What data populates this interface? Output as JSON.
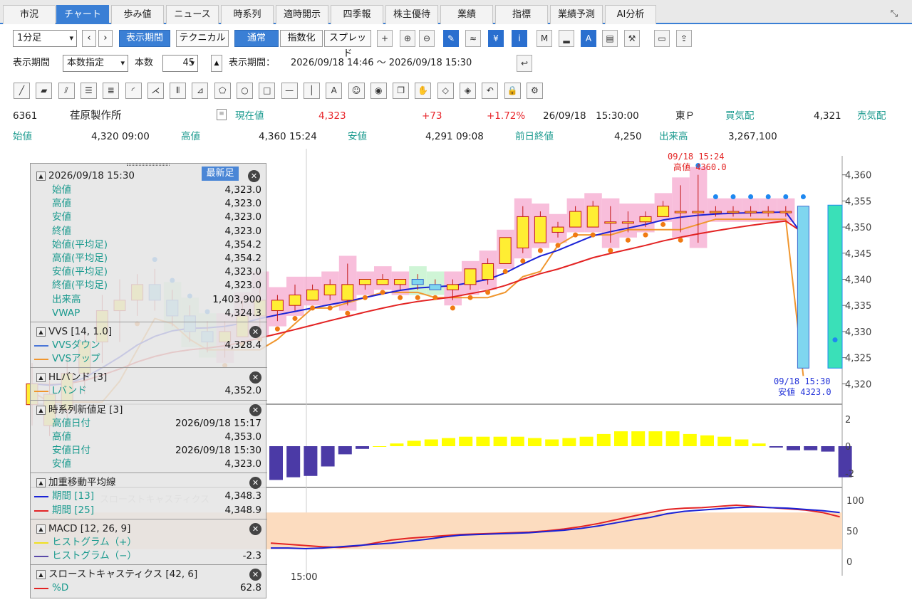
{
  "tabs": [
    "市況",
    "チャート",
    "歩み値",
    "ニュース",
    "時系列",
    "適時開示",
    "四季報",
    "株主優待",
    "業績",
    "指標",
    "業績予測",
    "AI分析"
  ],
  "active_tab": 1,
  "toolbar": {
    "interval": "1分足",
    "period_button": "表示期間",
    "technical_button": "テクニカル",
    "normal_button": "通常",
    "index_button": "指数化",
    "spread_button": "スプレッド",
    "period_label": "表示期間",
    "period_mode": "本数指定",
    "count_label": "本数",
    "count_value": "45",
    "range_label": "表示期間：",
    "range_value": "2026/09/18 14:46 ～ 2026/09/18 15:30"
  },
  "toolbar_icons": [
    "crosshair-icon",
    "zoom-in-icon",
    "zoom-out-icon",
    "pencil-icon",
    "scale-icon",
    "yen-icon",
    "info-icon",
    "my-icon",
    "volume-icon",
    "auto-icon",
    "chart-icon",
    "wrench-icon",
    "print-icon",
    "export-icon"
  ],
  "drawing_tools": [
    "line",
    "ruler",
    "parallel",
    "h-lines",
    "h-lines2",
    "arc",
    "fan",
    "v-lines",
    "gann",
    "pentagon",
    "circle",
    "rectangle",
    "h-line",
    "v-line",
    "text",
    "smile",
    "stamp",
    "copy",
    "hand",
    "eraser",
    "eraser2",
    "undo",
    "lock",
    "gear"
  ],
  "quote": {
    "code": "6361",
    "name": "荏原製作所",
    "current_label": "現在値",
    "current": "4,323",
    "change": "+73",
    "change_pct": "+1.72%",
    "datetime": "26/09/18　15:30:00",
    "market": "東Ｐ",
    "bid_label": "買気配",
    "bid": "4,321",
    "ask_label": "売気配",
    "open_label": "始値",
    "open": "4,320 09:00",
    "high_label": "高値",
    "high": "4,360 15:24",
    "low_label": "安値",
    "low": "4,291 09:08",
    "prev_label": "前日終値",
    "prev": "4,250",
    "volume_label": "出来高",
    "volume": "3,267,100"
  },
  "overlay": {
    "datetime": "2026/09/18 15:30",
    "newest_button": "最新足",
    "price_rows": [
      {
        "k": "始値",
        "v": "4,323.0"
      },
      {
        "k": "高値",
        "v": "4,323.0"
      },
      {
        "k": "安値",
        "v": "4,323.0"
      },
      {
        "k": "終値",
        "v": "4,323.0"
      },
      {
        "k": "始値(平均足)",
        "v": "4,354.2"
      },
      {
        "k": "高値(平均足)",
        "v": "4,354.2"
      },
      {
        "k": "安値(平均足)",
        "v": "4,323.0"
      },
      {
        "k": "終値(平均足)",
        "v": "4,323.0"
      },
      {
        "k": "出来高",
        "v": "1,403,900"
      },
      {
        "k": "VWAP",
        "v": "4,324.3"
      }
    ],
    "vvs_title": "VVS [14, 1.0]",
    "vvs_rows": [
      {
        "k": "VVSダウン",
        "v": "4,328.4",
        "c": "#4a76d8"
      },
      {
        "k": "VVSアップ",
        "v": "",
        "c": "#f0962e"
      }
    ],
    "hl_title": "HLバンド [3]",
    "hl_rows": [
      {
        "k": "Lバンド",
        "v": "4,352.0",
        "c": "#f0962e"
      }
    ],
    "ts_title": "時系列新値足 [3]",
    "ts_rows": [
      {
        "k": "高値日付",
        "v": "2026/09/18 15:17"
      },
      {
        "k": "高値",
        "v": "4,353.0"
      },
      {
        "k": "安値日付",
        "v": "2026/09/18 15:30"
      },
      {
        "k": "安値",
        "v": "4,323.0"
      }
    ],
    "wma_title": "加重移動平均線",
    "wma_rows": [
      {
        "k": "期間 [13]",
        "v": "4,348.3",
        "c": "#1a22d6"
      },
      {
        "k": "期間 [25]",
        "v": "4,348.9",
        "c": "#e32323"
      }
    ],
    "macd_title": "MACD [12, 26, 9]",
    "macd_rows": [
      {
        "k": "ヒストグラム（+）",
        "v": "",
        "c": "#f0e020"
      },
      {
        "k": "ヒストグラム（−）",
        "v": "-2.3",
        "c": "#5a4aa8"
      }
    ],
    "stoch_title": "スローストキャスティクス [42, 6]",
    "stoch_rows": [
      {
        "k": "%D",
        "v": "62.8",
        "c": "#e32323"
      }
    ],
    "watermark": "スローストキャスティクス"
  },
  "chart_data": {
    "type": "candlestick",
    "price_axis": {
      "range": [
        4318,
        4362
      ],
      "ticks": [
        "4,360",
        "4,355",
        "4,350",
        "4,345",
        "4,340",
        "4,335",
        "4,330",
        "4,325",
        "4,320"
      ]
    },
    "time_label": "15:00",
    "high_annotation": {
      "time": "09/18 15:24",
      "label": "高値 4360.0"
    },
    "low_annotation": {
      "time": "09/18 15:30",
      "label": "安値 4323.0"
    },
    "candles": [
      [
        4316,
        4320,
        4312,
        4324
      ],
      [
        4312,
        4318,
        4310,
        4322
      ],
      [
        4315,
        4322,
        4312,
        4325
      ],
      [
        4322,
        4328,
        4318,
        4330
      ],
      [
        4328,
        4334,
        4324,
        4337
      ],
      [
        4334,
        4336,
        4328,
        4340
      ],
      [
        4336,
        4339,
        4333,
        4341
      ],
      [
        4339,
        4336,
        4334,
        4342
      ],
      [
        4336,
        4333,
        4331,
        4338
      ],
      [
        4333,
        4330,
        4328,
        4335
      ],
      [
        4330,
        4328,
        4326,
        4332
      ],
      [
        4328,
        4330,
        4325,
        4332
      ],
      [
        4329,
        4333,
        4329,
        4336
      ],
      [
        4333,
        4336,
        4330,
        4340
      ],
      [
        4334,
        4336,
        4332,
        4337
      ],
      [
        4335,
        4337,
        4334,
        4339
      ],
      [
        4336,
        4338,
        4336,
        4339
      ],
      [
        4337,
        4339,
        4336,
        4340
      ],
      [
        4336,
        4339,
        4335,
        4343
      ],
      [
        4339,
        4340,
        4338,
        4340
      ],
      [
        4339,
        4340,
        4339,
        4341
      ],
      [
        4339,
        4340,
        4338,
        4340
      ],
      [
        4340,
        4339,
        4338,
        4341
      ],
      [
        4339,
        4338,
        4338,
        4340
      ],
      [
        4338,
        4339,
        4336,
        4340
      ],
      [
        4339,
        4342,
        4338,
        4342
      ],
      [
        4340,
        4343,
        4339,
        4344
      ],
      [
        4343,
        4348,
        4343,
        4348
      ],
      [
        4346,
        4352,
        4345,
        4354
      ],
      [
        4347,
        4352,
        4347,
        4353
      ],
      [
        4349,
        4350,
        4348,
        4351
      ],
      [
        4350,
        4353,
        4350,
        4354
      ],
      [
        4350,
        4354,
        4350,
        4355
      ],
      [
        4351,
        4351,
        4347,
        4354
      ],
      [
        4351,
        4351,
        4349,
        4353
      ],
      [
        4351,
        4352,
        4350,
        4353
      ],
      [
        4352,
        4354,
        4352,
        4355
      ],
      [
        4353,
        4353,
        4349,
        4358
      ],
      [
        4353,
        4353,
        4347,
        4360
      ],
      [
        4353,
        4353,
        4352,
        4354
      ],
      [
        4353,
        4353,
        4352,
        4354
      ],
      [
        4353,
        4353,
        4352,
        4354
      ],
      [
        4353,
        4353,
        4352,
        4354
      ],
      [
        4353,
        4353,
        4352,
        4354
      ],
      [
        4354,
        4323,
        4323,
        4354
      ]
    ],
    "macd_histogram": [
      -2.5,
      -2.3,
      -2.2,
      -1.5,
      -0.6,
      -0.2,
      0,
      0.2,
      0.4,
      0.5,
      0.6,
      0.7,
      0.7,
      0.7,
      0.7,
      0.6,
      0.5,
      0.6,
      0.7,
      0.9,
      1.1,
      1.1,
      1.1,
      1.1,
      0.9,
      0.8,
      0.7,
      0.5,
      0.2,
      -0.1,
      -0.3,
      -0.3,
      -0.4,
      -2.3
    ],
    "macd_axis": {
      "range": [
        -2.5,
        2.5
      ],
      "ticks": [
        "2",
        "0",
        "-2"
      ]
    },
    "stoch_axis": {
      "range": [
        0,
        100
      ],
      "ticks": [
        "100",
        "50",
        "0"
      ]
    }
  }
}
